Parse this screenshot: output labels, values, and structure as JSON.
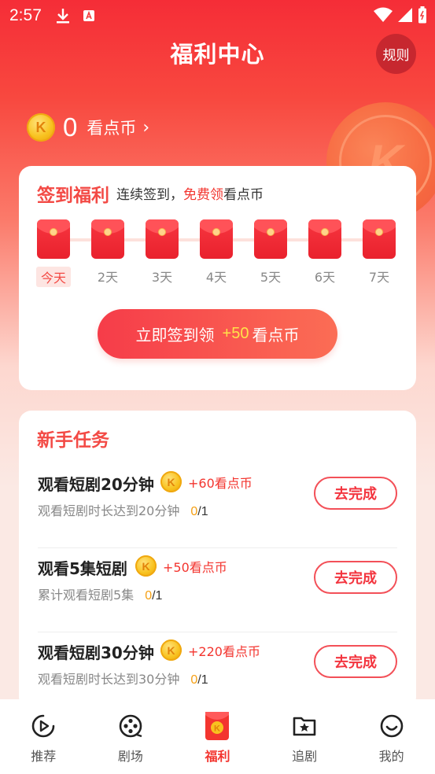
{
  "status_bar": {
    "time": "2:57"
  },
  "header": {
    "title": "福利中心",
    "rules_label": "规则"
  },
  "balance": {
    "coin_letter": "K",
    "amount": "0",
    "label": "看点币",
    "chevron": "›"
  },
  "signin": {
    "title": "签到福利",
    "subtitle_prefix": "连续签到，",
    "subtitle_highlight": "免费领",
    "subtitle_suffix": "看点币",
    "days": [
      "今天",
      "2天",
      "3天",
      "4天",
      "5天",
      "6天",
      "7天"
    ],
    "button_prefix": "立即签到领",
    "button_bonus": "+50",
    "button_unit": "看点币"
  },
  "tasks": {
    "title": "新手任务",
    "items": [
      {
        "name": "观看短剧20分钟",
        "reward": "+60看点币",
        "desc": "观看短剧时长达到20分钟",
        "done": "0",
        "total": "/1",
        "button": "去完成"
      },
      {
        "name": "观看5集短剧",
        "reward": "+50看点币",
        "desc": "累计观看短剧5集",
        "done": "0",
        "total": "/1",
        "button": "去完成"
      },
      {
        "name": "观看短剧30分钟",
        "reward": "+220看点币",
        "desc": "观看短剧时长达到30分钟",
        "done": "0",
        "total": "/1",
        "button": "去完成"
      }
    ]
  },
  "bottom_nav": {
    "items": [
      {
        "label": "推荐",
        "icon": "play-icon"
      },
      {
        "label": "剧场",
        "icon": "film-reel-icon"
      },
      {
        "label": "福利",
        "icon": "red-envelope-icon",
        "active": true
      },
      {
        "label": "追剧",
        "icon": "star-folder-icon"
      },
      {
        "label": "我的",
        "icon": "smiley-icon"
      }
    ]
  },
  "colors": {
    "accent": "#f3352f",
    "coin": "#f8c21f",
    "bonus_yellow": "#ffe24a"
  }
}
